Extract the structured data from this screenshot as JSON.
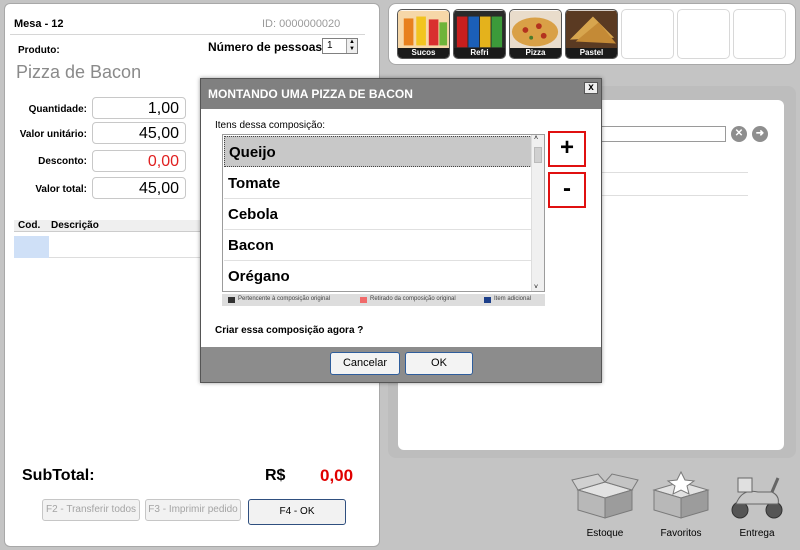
{
  "order": {
    "mesa": "Mesa - 12",
    "id": "ID: 0000000020",
    "produto_label": "Produto:",
    "pessoas_label": "Número de pessoas",
    "pessoas_value": "1",
    "produto_name": "Pizza de Bacon",
    "fields": [
      {
        "label": "Quantidade:",
        "value": "1,00",
        "red": false
      },
      {
        "label": "Valor unitário:",
        "value": "45,00",
        "red": false
      },
      {
        "label": "Desconto:",
        "value": "0,00",
        "red": true
      },
      {
        "label": "Valor total:",
        "value": "45,00",
        "red": false
      }
    ],
    "grid_cols": [
      "Cod.",
      "Descrição"
    ],
    "subtotal_label": "SubTotal:",
    "currency": "R$",
    "subtotal_value": "0,00",
    "btn_transferir": "F2 - Transferir todos",
    "btn_imprimir": "F3 - Imprimir pedido",
    "btn_ok": "F4 - OK"
  },
  "tiles": [
    {
      "label": "Sucos",
      "icon": "juice-image",
      "color": "#d46a2a"
    },
    {
      "label": "Refri",
      "icon": "soda-cans-image",
      "color": "#c0282a"
    },
    {
      "label": "Pizza",
      "icon": "pizza-image",
      "color": "#d99a3a"
    },
    {
      "label": "Pastel",
      "icon": "pastel-image",
      "color": "#c08a40"
    }
  ],
  "bottom_icons": [
    {
      "label": "Estoque",
      "icon": "box-icon"
    },
    {
      "label": "Favoritos",
      "icon": "favorites-box-icon"
    },
    {
      "label": "Entrega",
      "icon": "scooter-icon"
    }
  ],
  "dialog": {
    "title": "MONTANDO UMA PIZZA DE BACON",
    "close": "x",
    "items_label": "Itens dessa composição:",
    "items": [
      "Queijo",
      "Tomate",
      "Cebola",
      "Bacon",
      "Orégano"
    ],
    "legend": [
      {
        "text": "Pertencente à composição original",
        "color": "#333333"
      },
      {
        "text": "Retirado da composição original",
        "color": "#f06a6a"
      },
      {
        "text": "Item adicional",
        "color": "#1c3f8a"
      }
    ],
    "plus": "+",
    "minus": "-",
    "question": "Criar essa composição agora ?",
    "cancel": "Cancelar",
    "ok": "OK"
  }
}
